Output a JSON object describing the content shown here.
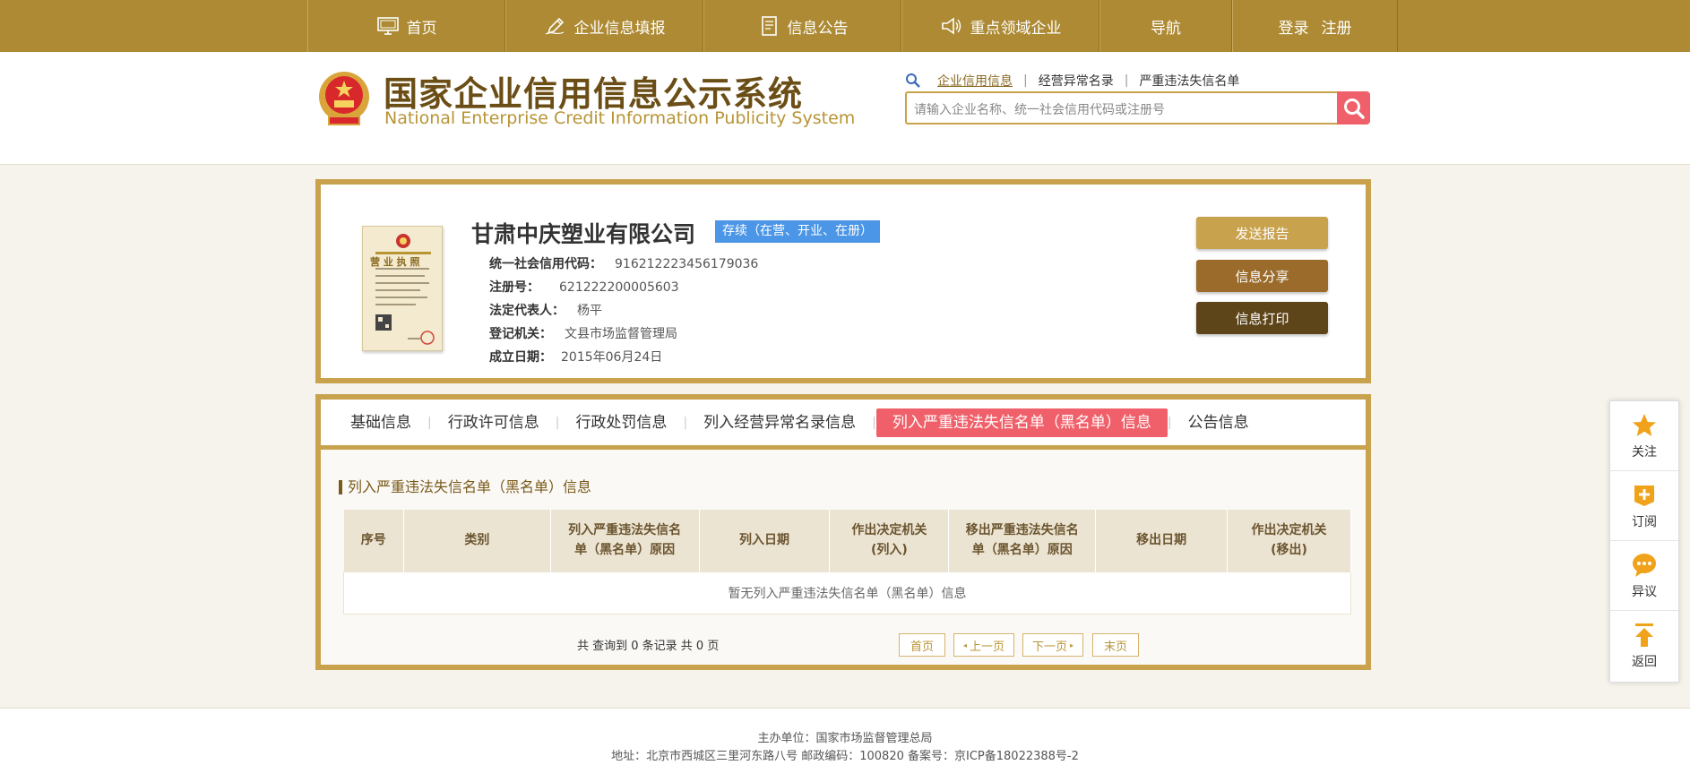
{
  "nav": {
    "items": [
      {
        "label": "首页",
        "icon": "monitor-icon"
      },
      {
        "label": "企业信息填报",
        "icon": "pen-icon"
      },
      {
        "label": "信息公告",
        "icon": "document-icon"
      },
      {
        "label": "重点领域企业",
        "icon": "speaker-icon"
      },
      {
        "label": "导航"
      }
    ],
    "login": "登录",
    "register": "注册"
  },
  "header": {
    "title_cn": "国家企业信用信息公示系统",
    "title_en": "National Enterprise Credit Information Publicity System"
  },
  "search": {
    "tabs": [
      "企业信用信息",
      "经营异常名录",
      "严重违法失信名单"
    ],
    "active_tab": "企业信用信息",
    "placeholder": "请输入企业名称、统一社会信用代码或注册号"
  },
  "company": {
    "name": "甘肃中庆塑业有限公司",
    "status": "存续（在营、开业、在册）",
    "fields": [
      {
        "label": "统一社会信用代码：",
        "value": "916212223456179036"
      },
      {
        "label": "注册号：",
        "value": "621222200005603"
      },
      {
        "label": "法定代表人：",
        "value": "杨平"
      },
      {
        "label": "登记机关：",
        "value": "文县市场监督管理局"
      },
      {
        "label": "成立日期：",
        "value": "2015年06月24日"
      }
    ],
    "license_title": "营 业 执 照"
  },
  "actions": {
    "send_report": "发送报告",
    "share": "信息分享",
    "print": "信息打印"
  },
  "tabs": [
    {
      "label": "基础信息"
    },
    {
      "label": "行政许可信息"
    },
    {
      "label": "行政处罚信息"
    },
    {
      "label": "列入经营异常名录信息"
    },
    {
      "label": "列入严重违法失信名单（黑名单）信息",
      "active": true
    },
    {
      "label": "公告信息"
    }
  ],
  "section": {
    "title": "列入严重违法失信名单（黑名单）信息",
    "columns": [
      "序号",
      "类别",
      "列入严重违法失信名单（黑名单）原因",
      "列入日期",
      "作出决定机关(列入)",
      "移出严重违法失信名单（黑名单）原因",
      "移出日期",
      "作出决定机关(移出)"
    ],
    "empty_text": "暂无列入严重违法失信名单（黑名单）信息"
  },
  "pager": {
    "summary": "共 查询到 0 条记录 共 0 页",
    "first": "首页",
    "prev": "上一页",
    "next": "下一页",
    "last": "末页"
  },
  "float": {
    "follow": "关注",
    "subscribe": "订阅",
    "objection": "异议",
    "back": "返回"
  },
  "footer": {
    "line1": "主办单位：国家市场监督管理总局",
    "line2": "地址：北京市西城区三里河东路八号   邮政编码：100820   备案号：京ICP备18022388号-2"
  },
  "colors": {
    "gold": "#ad8a33",
    "border": "#c9a24e",
    "accent_red": "#f0606a",
    "status_blue": "#4b96e6",
    "send_btn": "#c9a24e",
    "share_btn": "#9a6b2a",
    "print_btn": "#5e4419"
  }
}
